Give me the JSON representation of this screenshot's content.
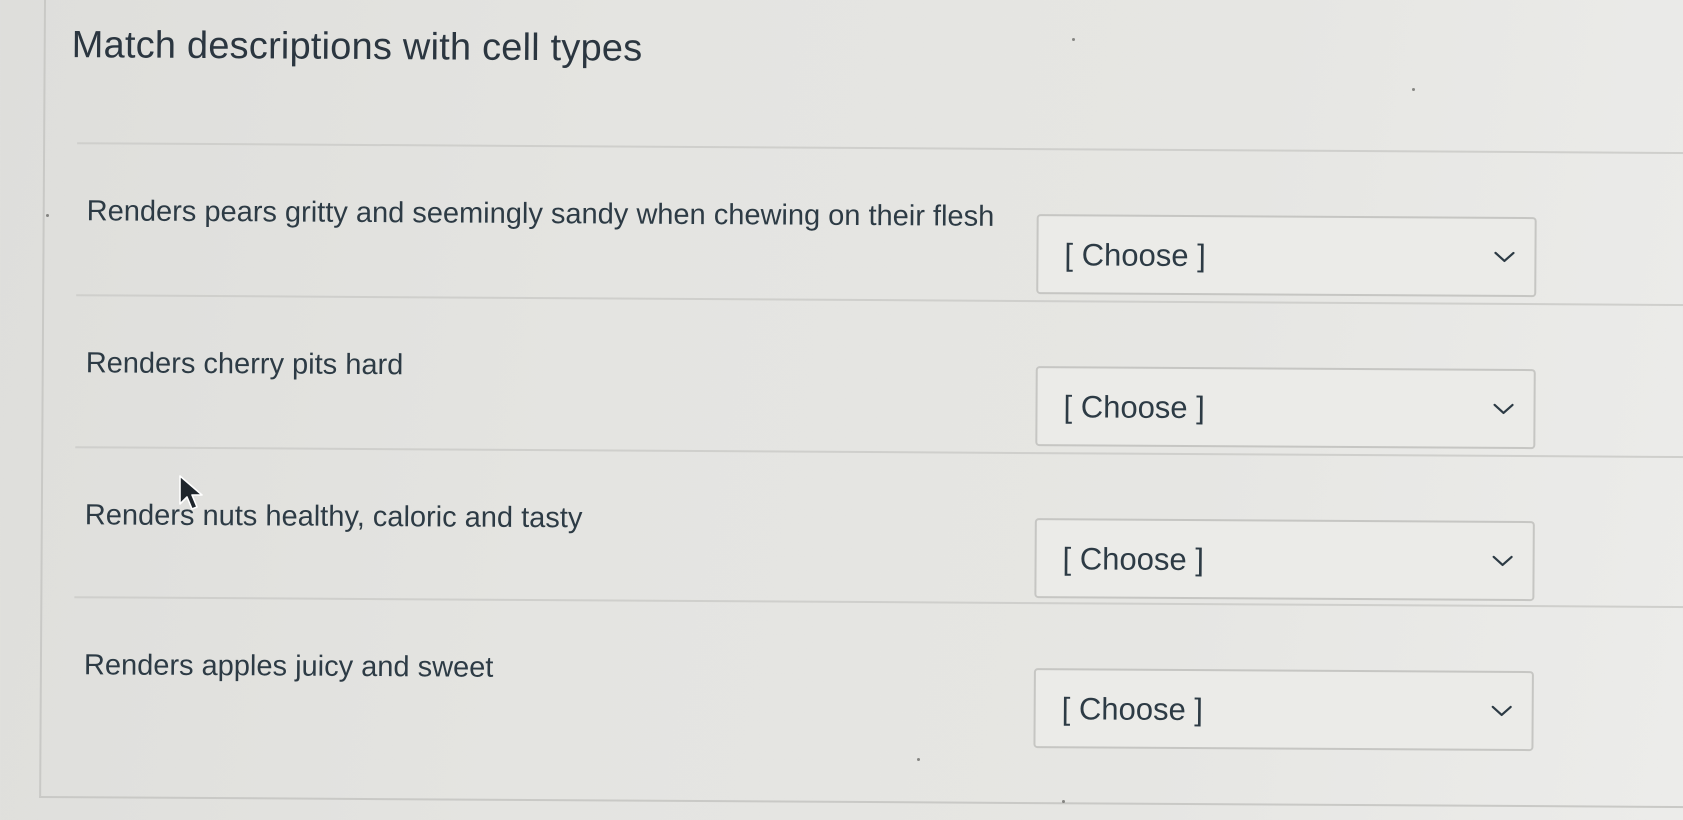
{
  "question": {
    "title": "Match descriptions with cell types"
  },
  "rows": [
    {
      "description": "Renders pears gritty and seemingly sandy when chewing on their flesh",
      "select_value": "[ Choose ]",
      "icon": "chevron-down-icon"
    },
    {
      "description": "Renders cherry pits hard",
      "select_value": "[ Choose ]",
      "icon": "chevron-down-icon"
    },
    {
      "description": "Renders nuts healthy, caloric and tasty",
      "select_value": "[ Choose ]",
      "icon": "chevron-down-icon"
    },
    {
      "description": "Renders apples juicy and sweet",
      "select_value": "[ Choose ]",
      "icon": "chevron-down-icon"
    }
  ],
  "cursor": {
    "icon": "mouse-pointer-icon"
  },
  "colors": {
    "text": "#2d3b45",
    "background": "#e4e4e1",
    "border": "#c6c6c3"
  }
}
